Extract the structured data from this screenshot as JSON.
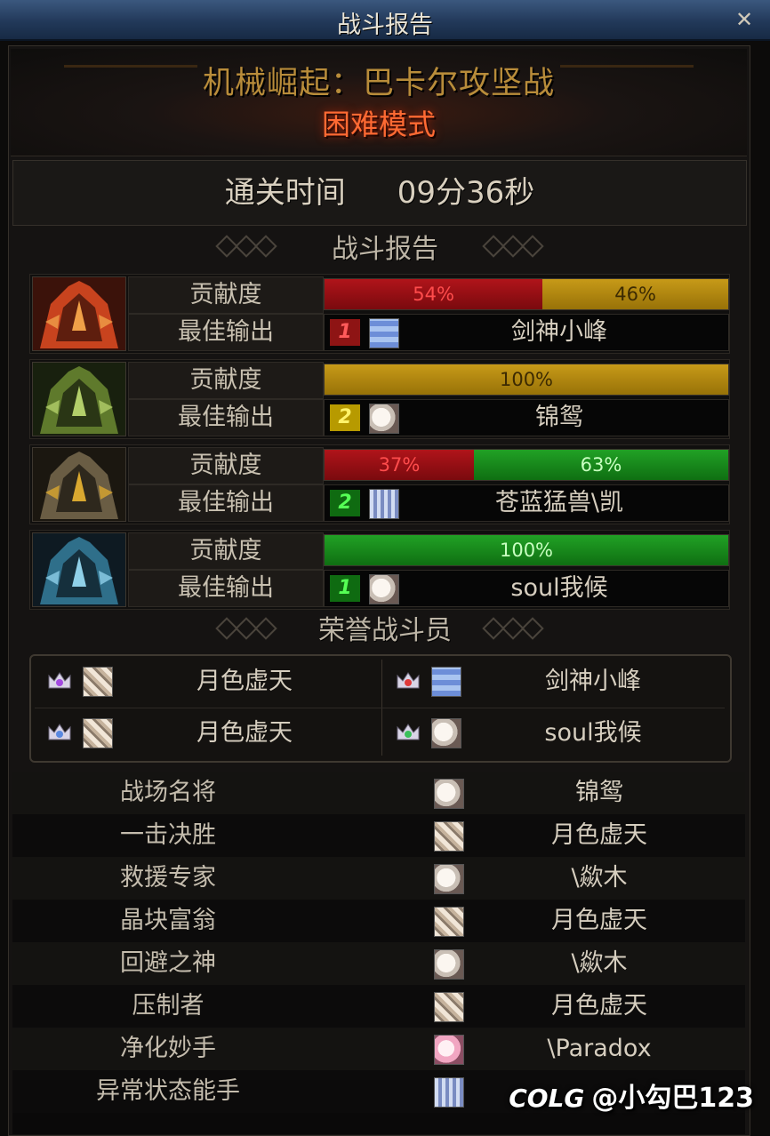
{
  "window": {
    "title": "战斗报告",
    "close_icon": "close-icon"
  },
  "dungeon": {
    "name": "机械崛起：巴卡尔攻坚战",
    "mode": "困难模式"
  },
  "clear_time": {
    "label": "通关时间",
    "value": "09分36秒"
  },
  "sections": {
    "report": "战斗报告",
    "honor": "荣誉战斗员"
  },
  "bosses": [
    {
      "icon": "red-dragon-boss-icon",
      "contribution_label": "贡献度",
      "best_label": "最佳输出",
      "segments": [
        {
          "color": "red",
          "value": 54,
          "label": "54%"
        },
        {
          "color": "gold",
          "value": 46,
          "label": "46%"
        }
      ],
      "best": {
        "rank": "1",
        "rank_color": "red",
        "avatar": "blue",
        "name": "剑神小峰"
      }
    },
    {
      "icon": "green-dragon-boss-icon",
      "contribution_label": "贡献度",
      "best_label": "最佳输出",
      "segments": [
        {
          "color": "gold",
          "value": 100,
          "label": "100%"
        }
      ],
      "best": {
        "rank": "2",
        "rank_color": "yellow",
        "avatar": "white",
        "name": "锦鸳"
      }
    },
    {
      "icon": "gold-dragon-boss-icon",
      "contribution_label": "贡献度",
      "best_label": "最佳输出",
      "segments": [
        {
          "color": "red",
          "value": 37,
          "label": "37%"
        },
        {
          "color": "green",
          "value": 63,
          "label": "63%"
        }
      ],
      "best": {
        "rank": "2",
        "rank_color": "green",
        "avatar": "blue-white",
        "name": "苍蓝猛兽\\凯"
      }
    },
    {
      "icon": "blue-dragon-boss-icon",
      "contribution_label": "贡献度",
      "best_label": "最佳输出",
      "segments": [
        {
          "color": "green",
          "value": 100,
          "label": "100%"
        }
      ],
      "best": {
        "rank": "1",
        "rank_color": "green",
        "avatar": "white",
        "name": "soul我候"
      }
    }
  ],
  "honor": [
    {
      "crown": "purple",
      "avatar": "stripe",
      "name": "月色虚天"
    },
    {
      "crown": "red",
      "avatar": "blue",
      "name": "剑神小峰"
    },
    {
      "crown": "blue",
      "avatar": "stripe",
      "name": "月色虚天"
    },
    {
      "crown": "green",
      "avatar": "white",
      "name": "soul我候"
    }
  ],
  "awards": [
    {
      "title": "战场名将",
      "avatar": "white",
      "player": "锦鸳"
    },
    {
      "title": "一击决胜",
      "avatar": "stripe",
      "player": "月色虚天"
    },
    {
      "title": "救援专家",
      "avatar": "white",
      "player": "\\歘木"
    },
    {
      "title": "晶块富翁",
      "avatar": "stripe",
      "player": "月色虚天"
    },
    {
      "title": "回避之神",
      "avatar": "white",
      "player": "\\歘木"
    },
    {
      "title": "压制者",
      "avatar": "stripe",
      "player": "月色虚天"
    },
    {
      "title": "净化妙手",
      "avatar": "pink",
      "player": "\\Paradox"
    },
    {
      "title": "异常状态能手",
      "avatar": "blue-white",
      "player": ""
    }
  ],
  "watermark": {
    "logo": "COLG",
    "text": "@小勾巴123"
  },
  "colors": {
    "title_bar": "#22395a",
    "bar_red": "#b0141a",
    "bar_gold": "#c79a18",
    "bar_green": "#21a125",
    "mode_text": "#ff6a33",
    "dungeon_text": "#b88c3a"
  }
}
